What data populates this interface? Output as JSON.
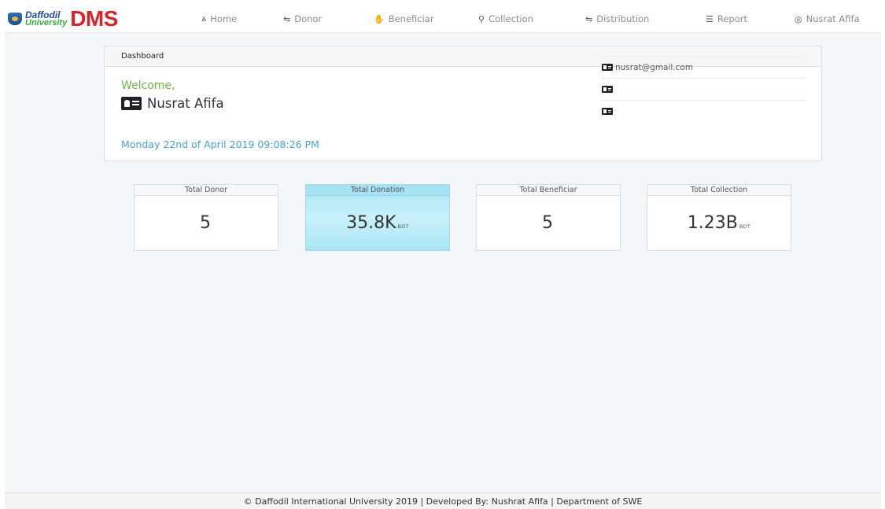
{
  "brand": {
    "line1": "Daffodil",
    "line2": "University",
    "app_name": "DMS"
  },
  "nav": {
    "items": [
      {
        "label": "Home",
        "icon": "home-icon"
      },
      {
        "label": "Donor",
        "icon": "donor-icon"
      },
      {
        "label": "Beneficiar",
        "icon": "hand-icon"
      },
      {
        "label": "Collection",
        "icon": "binoculars-icon"
      },
      {
        "label": "Distribution",
        "icon": "distribution-icon"
      },
      {
        "label": "Report",
        "icon": "list-icon"
      }
    ],
    "user": {
      "label": "Nusrat Afifa",
      "icon": "user-circle-icon"
    }
  },
  "dashboard": {
    "heading": "Dashboard",
    "welcome": "Welcome,",
    "user_name": "Nusrat Afifa",
    "datetime": "Monday 22nd of April 2019 09:08:26 PM",
    "info": [
      {
        "icon": "id-card-icon",
        "text": "nusrat@gmail.com"
      },
      {
        "icon": "id-card-icon",
        "text": ""
      },
      {
        "icon": "id-card-icon",
        "text": ""
      }
    ]
  },
  "stats": [
    {
      "title": "Total Donor",
      "value": "5",
      "unit": ""
    },
    {
      "title": "Total Donation",
      "value": "35.8K",
      "unit": "BDT"
    },
    {
      "title": "Total Beneficiar",
      "value": "5",
      "unit": ""
    },
    {
      "title": "Total Collection",
      "value": "1.23B",
      "unit": "BDT"
    }
  ],
  "colors": {
    "brand_red": "#d5242a",
    "welcome_green": "#6bb64a",
    "datetime_blue": "#4aa0d8",
    "highlight_cyan": "#a9e6f5"
  },
  "footer": {
    "text": "© Daffodil International University 2019 | Developed By: Nushrat Afifa | Department of SWE"
  }
}
